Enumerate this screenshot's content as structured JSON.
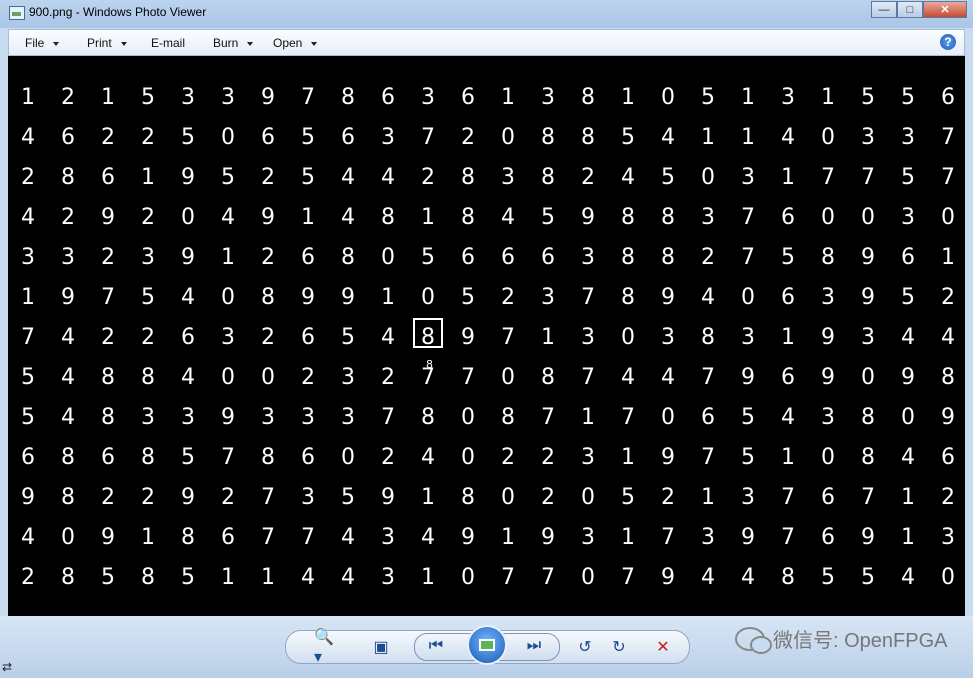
{
  "window": {
    "title": "900.png - Windows Photo Viewer",
    "minimize_icon": "minimize-icon",
    "maximize_icon": "maximize-icon",
    "close_icon": "close-icon"
  },
  "menubar": {
    "file": "File",
    "print": "Print",
    "email": "E-mail",
    "burn": "Burn",
    "open": "Open"
  },
  "image": {
    "rows": [
      [
        "1",
        "2",
        "1",
        "5",
        "3",
        "3",
        "9",
        "7",
        "8",
        "6",
        "3",
        "6",
        "1",
        "3",
        "8",
        "1",
        "0",
        "5",
        "1",
        "3",
        "1",
        "5",
        "5",
        "6"
      ],
      [
        "4",
        "6",
        "2",
        "2",
        "5",
        "0",
        "6",
        "5",
        "6",
        "3",
        "7",
        "2",
        "0",
        "8",
        "8",
        "5",
        "4",
        "1",
        "1",
        "4",
        "0",
        "3",
        "3",
        "7"
      ],
      [
        "2",
        "8",
        "6",
        "1",
        "9",
        "5",
        "2",
        "5",
        "4",
        "4",
        "2",
        "8",
        "3",
        "8",
        "2",
        "4",
        "5",
        "0",
        "3",
        "1",
        "7",
        "7",
        "5",
        "7"
      ],
      [
        "4",
        "2",
        "9",
        "2",
        "0",
        "4",
        "9",
        "1",
        "4",
        "8",
        "1",
        "8",
        "4",
        "5",
        "9",
        "8",
        "8",
        "3",
        "7",
        "6",
        "0",
        "0",
        "3",
        "0"
      ],
      [
        "3",
        "3",
        "2",
        "3",
        "9",
        "1",
        "2",
        "6",
        "8",
        "0",
        "5",
        "6",
        "6",
        "6",
        "3",
        "8",
        "8",
        "2",
        "7",
        "5",
        "8",
        "9",
        "6",
        "1"
      ],
      [
        "1",
        "9",
        "7",
        "5",
        "4",
        "0",
        "8",
        "9",
        "9",
        "1",
        "0",
        "5",
        "2",
        "3",
        "7",
        "8",
        "9",
        "4",
        "0",
        "6",
        "3",
        "9",
        "5",
        "2"
      ],
      [
        "7",
        "4",
        "2",
        "2",
        "6",
        "3",
        "2",
        "6",
        "5",
        "4",
        "8",
        "9",
        "7",
        "1",
        "3",
        "0",
        "3",
        "8",
        "3",
        "1",
        "9",
        "3",
        "4",
        "4"
      ],
      [
        "5",
        "4",
        "8",
        "8",
        "4",
        "0",
        "0",
        "2",
        "3",
        "2",
        "7",
        "7",
        "0",
        "8",
        "7",
        "4",
        "4",
        "7",
        "9",
        "6",
        "9",
        "0",
        "9",
        "8"
      ],
      [
        "5",
        "4",
        "8",
        "3",
        "3",
        "9",
        "3",
        "3",
        "3",
        "7",
        "8",
        "0",
        "8",
        "7",
        "1",
        "7",
        "0",
        "6",
        "5",
        "4",
        "3",
        "8",
        "0",
        "9"
      ],
      [
        "6",
        "8",
        "6",
        "8",
        "5",
        "7",
        "8",
        "6",
        "0",
        "2",
        "4",
        "0",
        "2",
        "2",
        "3",
        "1",
        "9",
        "7",
        "5",
        "1",
        "0",
        "8",
        "4",
        "6"
      ],
      [
        "9",
        "8",
        "2",
        "2",
        "9",
        "2",
        "7",
        "3",
        "5",
        "9",
        "1",
        "8",
        "0",
        "2",
        "0",
        "5",
        "2",
        "1",
        "3",
        "7",
        "6",
        "7",
        "1",
        "2"
      ],
      [
        "4",
        "0",
        "9",
        "1",
        "8",
        "6",
        "7",
        "7",
        "4",
        "3",
        "4",
        "9",
        "1",
        "9",
        "3",
        "1",
        "7",
        "3",
        "9",
        "7",
        "6",
        "9",
        "1",
        "3"
      ],
      [
        "2",
        "8",
        "5",
        "8",
        "5",
        "1",
        "1",
        "4",
        "4",
        "3",
        "1",
        "0",
        "7",
        "7",
        "0",
        "7",
        "9",
        "4",
        "4",
        "8",
        "5",
        "5",
        "4",
        "0"
      ]
    ],
    "cursor_label": "8"
  },
  "bottombar": {
    "watermark": "微信号: OpenFPGA"
  }
}
